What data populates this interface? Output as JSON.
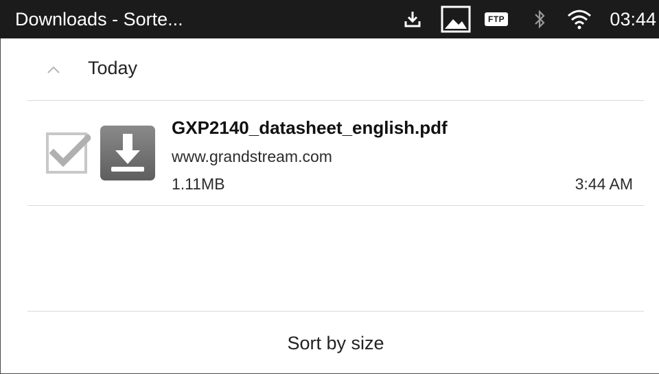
{
  "status_bar": {
    "title": "Downloads - Sorte...",
    "icons": [
      "download-icon",
      "image-icon",
      "ftp-icon",
      "bluetooth-icon",
      "wifi-icon"
    ],
    "ftp_label": "FTP",
    "time": "03:44",
    "background": "#1b1b1b"
  },
  "section": {
    "label": "Today",
    "expanded": true
  },
  "downloads": [
    {
      "file_name": "GXP2140_datasheet_english.pdf",
      "source": "www.grandstream.com",
      "size": "1.11MB",
      "time": "3:44 AM",
      "checked": true
    }
  ],
  "footer": {
    "sort_label": "Sort by size"
  }
}
